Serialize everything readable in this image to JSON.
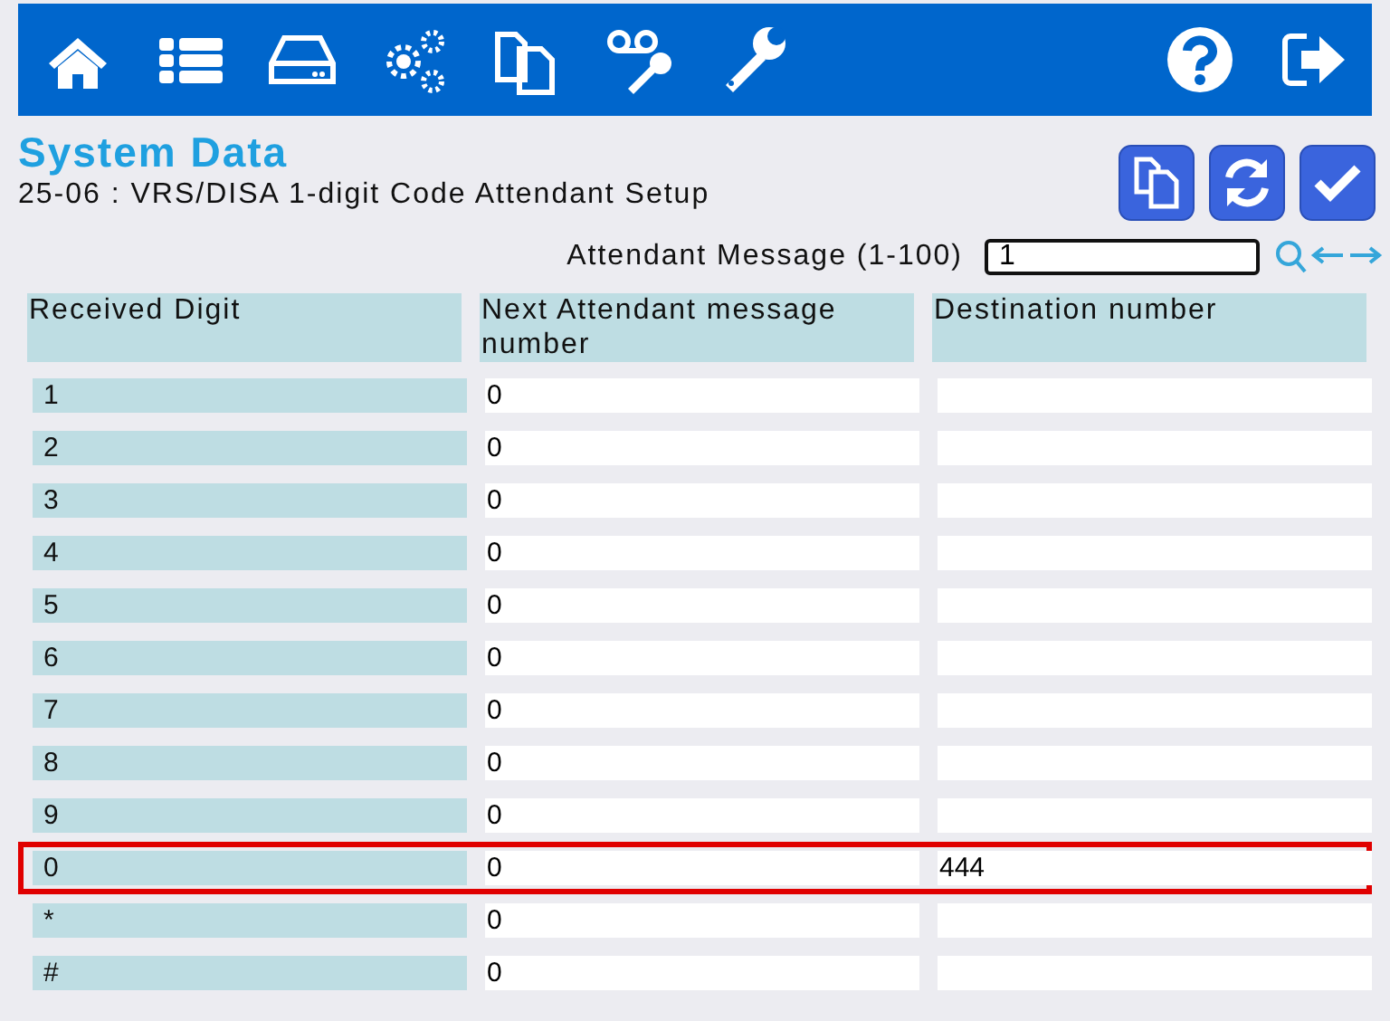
{
  "toolbar": {
    "left_icons": [
      {
        "kind": "home"
      },
      {
        "kind": "list"
      },
      {
        "kind": "drive"
      },
      {
        "kind": "gears"
      },
      {
        "kind": "copy"
      },
      {
        "kind": "voicemail-wrench"
      },
      {
        "kind": "wrench"
      }
    ],
    "right_icons": [
      {
        "kind": "help"
      },
      {
        "kind": "logout"
      }
    ]
  },
  "title": "System Data",
  "subtitle": "25-06 : VRS/DISA 1-digit Code Attendant Setup",
  "actions": [
    {
      "kind": "copy"
    },
    {
      "kind": "refresh"
    },
    {
      "kind": "apply"
    }
  ],
  "search": {
    "label": "Attendant Message (1-100)",
    "value": "1"
  },
  "table": {
    "columns": [
      "Received Digit",
      "Next Attendant message number",
      "Destination number"
    ],
    "rows": [
      {
        "digit": "1",
        "next": "0",
        "destination": "",
        "selected": false
      },
      {
        "digit": "2",
        "next": "0",
        "destination": "",
        "selected": false
      },
      {
        "digit": "3",
        "next": "0",
        "destination": "",
        "selected": false
      },
      {
        "digit": "4",
        "next": "0",
        "destination": "",
        "selected": false
      },
      {
        "digit": "5",
        "next": "0",
        "destination": "",
        "selected": false
      },
      {
        "digit": "6",
        "next": "0",
        "destination": "",
        "selected": false
      },
      {
        "digit": "7",
        "next": "0",
        "destination": "",
        "selected": false
      },
      {
        "digit": "8",
        "next": "0",
        "destination": "",
        "selected": false
      },
      {
        "digit": "9",
        "next": "0",
        "destination": "",
        "selected": false
      },
      {
        "digit": "0",
        "next": "0",
        "destination": "444",
        "selected": true
      },
      {
        "digit": "*",
        "next": "0",
        "destination": "",
        "selected": false
      },
      {
        "digit": "#",
        "next": "0",
        "destination": "",
        "selected": false
      }
    ]
  }
}
